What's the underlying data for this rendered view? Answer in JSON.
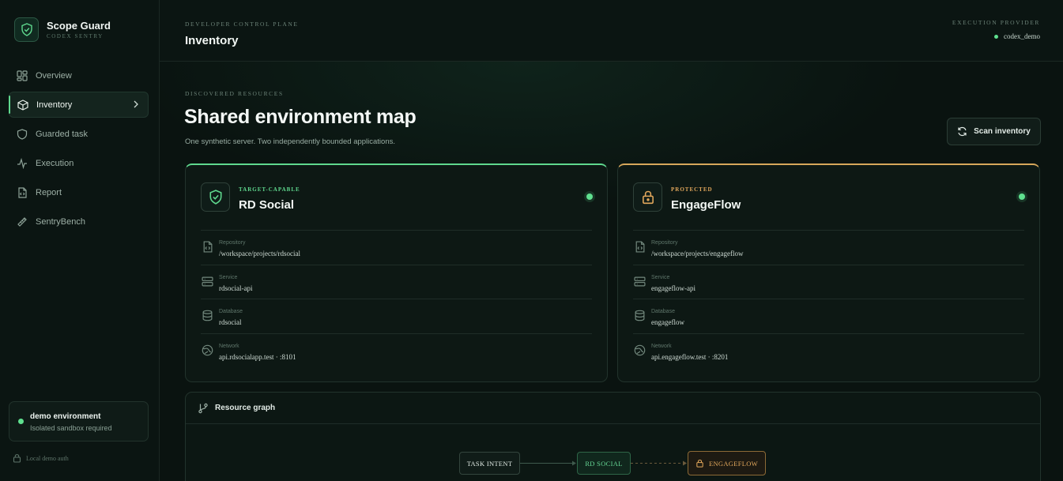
{
  "brand": {
    "name": "Scope Guard",
    "subtitle": "CODEX SENTRY"
  },
  "nav": {
    "items": [
      {
        "label": "Overview",
        "icon": "grid-icon"
      },
      {
        "label": "Inventory",
        "icon": "cube-icon",
        "active": true
      },
      {
        "label": "Guarded task",
        "icon": "shield-icon"
      },
      {
        "label": "Execution",
        "icon": "activity-icon"
      },
      {
        "label": "Report",
        "icon": "file-code-icon"
      },
      {
        "label": "SentryBench",
        "icon": "ruler-icon"
      }
    ]
  },
  "environment": {
    "title": "demo environment",
    "subtitle": "Isolated sandbox required",
    "status_color": "#5fe08f"
  },
  "auth": {
    "label": "Local demo auth"
  },
  "header": {
    "eyebrow": "DEVELOPER CONTROL PLANE",
    "title": "Inventory",
    "provider_label": "EXECUTION PROVIDER",
    "provider_value": "codex_demo"
  },
  "main": {
    "eyebrow": "DISCOVERED RESOURCES",
    "title": "Shared environment map",
    "subtitle": "One synthetic server. Two independently bounded applications.",
    "scan_label": "Scan inventory"
  },
  "apps": [
    {
      "tag": "TARGET-CAPABLE",
      "name": "RD Social",
      "accent": "#5fd88e",
      "rows": [
        {
          "label": "Repository",
          "value": "/workspace/projects/rdsocial"
        },
        {
          "label": "Service",
          "value": "rdsocial-api"
        },
        {
          "label": "Database",
          "value": "rdsocial"
        },
        {
          "label": "Network",
          "value": "api.rdsocialapp.test · :8101"
        }
      ]
    },
    {
      "tag": "PROTECTED",
      "name": "EngageFlow",
      "accent": "#d7a75b",
      "rows": [
        {
          "label": "Repository",
          "value": "/workspace/projects/engageflow"
        },
        {
          "label": "Service",
          "value": "engageflow-api"
        },
        {
          "label": "Database",
          "value": "engageflow"
        },
        {
          "label": "Network",
          "value": "api.engageflow.test · :8201"
        }
      ]
    }
  ],
  "graph": {
    "title": "Resource graph",
    "nodes": {
      "intent": "TASK INTENT",
      "rd": "RD SOCIAL",
      "ef": "ENGAGEFLOW"
    }
  }
}
